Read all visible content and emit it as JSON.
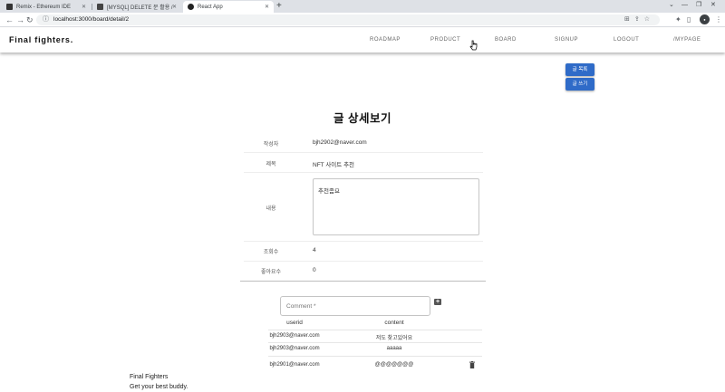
{
  "browser": {
    "tabs": [
      {
        "title": "Remix - Ethereum IDE",
        "favicon_color": "#333333"
      },
      {
        "title": "[MYSQL] DELETE 문 활용 /",
        "favicon_color": "#444444"
      },
      {
        "title": "React App",
        "favicon_color": "#222222"
      }
    ],
    "active_tab": 2,
    "url": "localhost:3000/board/detail/2"
  },
  "app": {
    "brand": "Final fighters.",
    "menu": [
      "ROADMAP",
      "PRODUCT",
      "BOARD",
      "SIGNUP",
      "LOGOUT",
      "/MYPAGE"
    ],
    "actions": {
      "list_label": "글 목록",
      "write_label": "글 쓰기"
    },
    "accent_color": "#2f6bc8"
  },
  "detail": {
    "title": "글 상세보기",
    "rows": [
      {
        "label": "작성자",
        "value": "bjh2902@naver.com"
      },
      {
        "label": "제목",
        "value": "NFT 사이트 추천"
      },
      {
        "label": "내용",
        "value": "추천좀요"
      },
      {
        "label": "조회수",
        "value": "4"
      },
      {
        "label": "좋아요수",
        "value": "0"
      }
    ]
  },
  "comments": {
    "placeholder": "Comment *",
    "headers": [
      "userid",
      "content"
    ],
    "items": [
      {
        "userid": "bjh2903@naver.com",
        "content": "저도 찾고있어요"
      },
      {
        "userid": "bjh2903@naver.com",
        "content": "aaaaa"
      },
      {
        "userid": "bjh2901@naver.com",
        "content": "@@@@@@@"
      }
    ]
  },
  "footer": {
    "name": "Final Fighters",
    "tagline": "Get your best buddy."
  }
}
